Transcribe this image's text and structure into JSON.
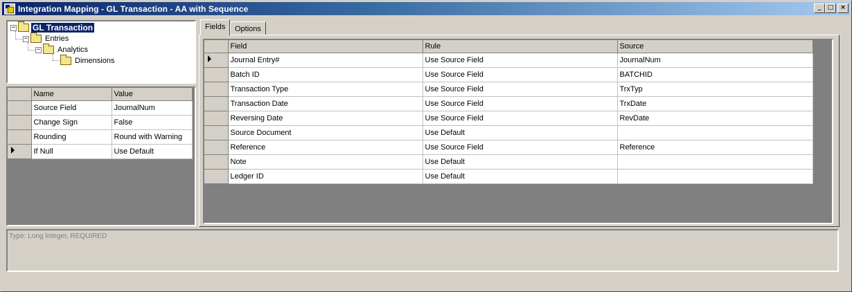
{
  "window": {
    "title": "Integration Mapping - GL Transaction - AA with Sequence",
    "minimize": "_",
    "maximize": "□",
    "close": "×"
  },
  "tree": {
    "nodes": [
      {
        "label": "GL Transaction",
        "toggle": "−"
      },
      {
        "label": "Entries",
        "toggle": "−"
      },
      {
        "label": "Analytics",
        "toggle": "−"
      },
      {
        "label": "Dimensions"
      }
    ]
  },
  "properties": {
    "headers": [
      "Name",
      "Value"
    ],
    "rows": [
      {
        "name": "Source Field",
        "value": "JournalNum"
      },
      {
        "name": "Change Sign",
        "value": "False"
      },
      {
        "name": "Rounding",
        "value": "Round with Warning"
      },
      {
        "name": "If Null",
        "value": "Use Default"
      }
    ],
    "current_row": 3
  },
  "tabs": [
    {
      "label": "Fields",
      "active": true
    },
    {
      "label": "Options",
      "active": false
    }
  ],
  "fields": {
    "headers": [
      "Field",
      "Rule",
      "Source"
    ],
    "rows": [
      {
        "field": "Journal Entry#",
        "rule": "Use Source Field",
        "source": "JournalNum"
      },
      {
        "field": "Batch ID",
        "rule": "Use Source Field",
        "source": "BATCHID"
      },
      {
        "field": "Transaction Type",
        "rule": "Use Source Field",
        "source": "TrxTyp"
      },
      {
        "field": "Transaction Date",
        "rule": "Use Source Field",
        "source": "TrxDate"
      },
      {
        "field": "Reversing Date",
        "rule": "Use Source Field",
        "source": "RevDate"
      },
      {
        "field": "Source Document",
        "rule": "Use Default",
        "source": ""
      },
      {
        "field": "Reference",
        "rule": "Use Source Field",
        "source": "Reference"
      },
      {
        "field": "Note",
        "rule": "Use Default",
        "source": ""
      },
      {
        "field": "Ledger ID",
        "rule": "Use Default",
        "source": ""
      }
    ],
    "current_row": 0
  },
  "status": {
    "text": "Type: Long Integer, REQUIRED"
  },
  "colors": {
    "title_start": "#0a246a",
    "title_end": "#a6caf0",
    "face": "#d4d0c8",
    "selection": "#0a246a"
  }
}
